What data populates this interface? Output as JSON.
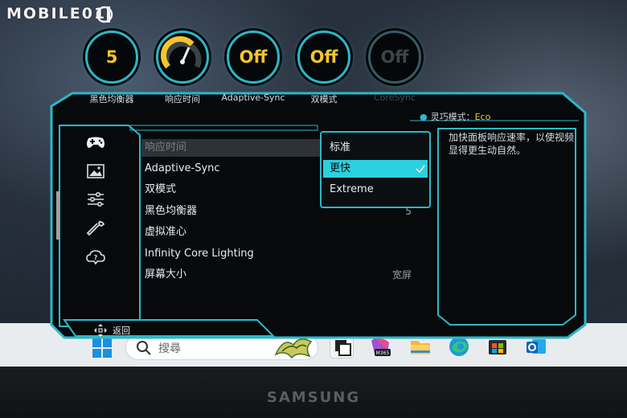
{
  "watermark": {
    "text": "MOBILE01"
  },
  "gauges": [
    {
      "value": "5",
      "label": "黑色均衡器",
      "disabled": false
    },
    {
      "value": "",
      "label": "响应时间",
      "disabled": false
    },
    {
      "value": "Off",
      "label": "Adaptive-Sync",
      "disabled": false
    },
    {
      "value": "Off",
      "label": "双模式",
      "disabled": false
    },
    {
      "value": "Off",
      "label": "CoreSync",
      "disabled": true
    }
  ],
  "status": {
    "label": "灵巧模式：",
    "value": "Eco"
  },
  "sidebar": {
    "icons": [
      "gamepad-icon",
      "picture-icon",
      "sliders-icon",
      "wrench-icon",
      "cloud-help-icon"
    ]
  },
  "menu": {
    "items": [
      {
        "label": "响应时间",
        "value": "",
        "active": true
      },
      {
        "label": "Adaptive-Sync",
        "value": ""
      },
      {
        "label": "双模式",
        "value": ""
      },
      {
        "label": "黑色均衡器",
        "value": "5"
      },
      {
        "label": "虚拟准心",
        "value": ""
      },
      {
        "label": "Infinity Core Lighting",
        "value": ""
      },
      {
        "label": "屏幕大小",
        "value": "宽屏"
      }
    ]
  },
  "dropdown": {
    "options": [
      {
        "label": "标准",
        "selected": false
      },
      {
        "label": "更快",
        "selected": true
      },
      {
        "label": "Extreme",
        "selected": false
      }
    ]
  },
  "description": {
    "text": "加快面板响应速率，以使视频显得更生动自然。"
  },
  "footer": {
    "back_label": "返回"
  },
  "taskbar": {
    "search_placeholder": "搜尋"
  },
  "bezel": {
    "brand": "SAMSUNG"
  },
  "colors": {
    "accent": "#2bb8c9",
    "highlight": "#2bd1e0",
    "value_yellow": "#f7c52c"
  }
}
